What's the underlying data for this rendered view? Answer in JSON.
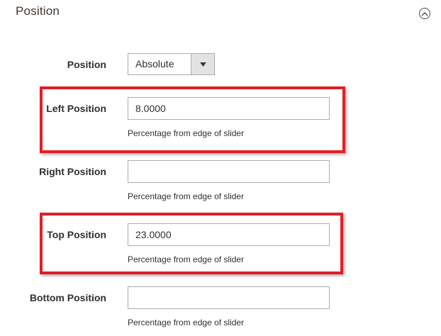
{
  "section": {
    "title": "Position"
  },
  "fields": {
    "position": {
      "label": "Position",
      "value": "Absolute"
    },
    "left": {
      "label": "Left Position",
      "value": "8.0000",
      "note": "Percentage from edge of slider"
    },
    "right": {
      "label": "Right Position",
      "value": "",
      "note": "Percentage from edge of slider"
    },
    "top": {
      "label": "Top Position",
      "value": "23.0000",
      "note": "Percentage from edge of slider"
    },
    "bottom": {
      "label": "Bottom Position",
      "value": "",
      "note": "Percentage from edge of slider"
    }
  },
  "icons": {
    "collapse": "chevron-up-circle-icon",
    "dropdown": "triangle-down-icon"
  },
  "colors": {
    "highlight": "#e01f26",
    "border": "#adadad",
    "select_button": "#e3e3e3",
    "text": "#303030"
  }
}
